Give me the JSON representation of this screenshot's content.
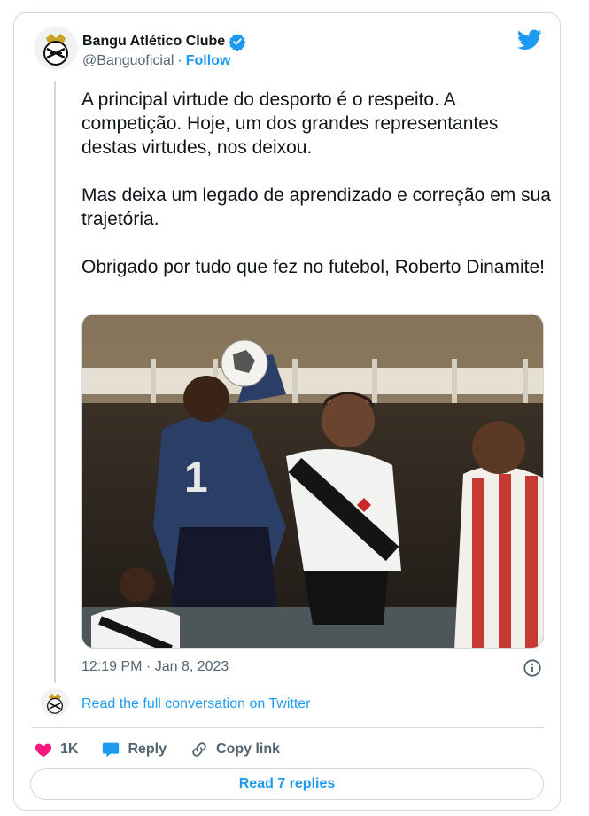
{
  "author": {
    "display_name": "Bangu Atlético Clube",
    "handle": "@Banguoficial",
    "separator": "·",
    "follow_label": "Follow"
  },
  "tweet": {
    "paragraph_1": "A principal virtude do desporto é o respeito. A competição. Hoje, um dos grandes representantes destas virtudes, nos deixou.",
    "paragraph_2": "Mas deixa um legado de aprendizado e correção em sua trajetória.",
    "paragraph_3": "Obrigado por tudo que fez no futebol, Roberto Dinamite!",
    "timestamp": "12:19 PM · Jan 8, 2023"
  },
  "conversation": {
    "link_label": "Read the full conversation on Twitter"
  },
  "actions": {
    "like_count": "1K",
    "reply_label": "Reply",
    "copy_label": "Copy link"
  },
  "footer": {
    "read_replies_label": "Read 7 replies"
  },
  "colors": {
    "accent": "#1d9bf0",
    "like": "#f91880",
    "muted": "#536471",
    "border": "#cfd9de"
  },
  "icons": {
    "verified": "verified-badge-icon",
    "brand": "twitter-bird-icon",
    "info": "info-icon",
    "like": "heart-icon",
    "reply": "speech-bubble-icon",
    "copy": "link-icon"
  }
}
